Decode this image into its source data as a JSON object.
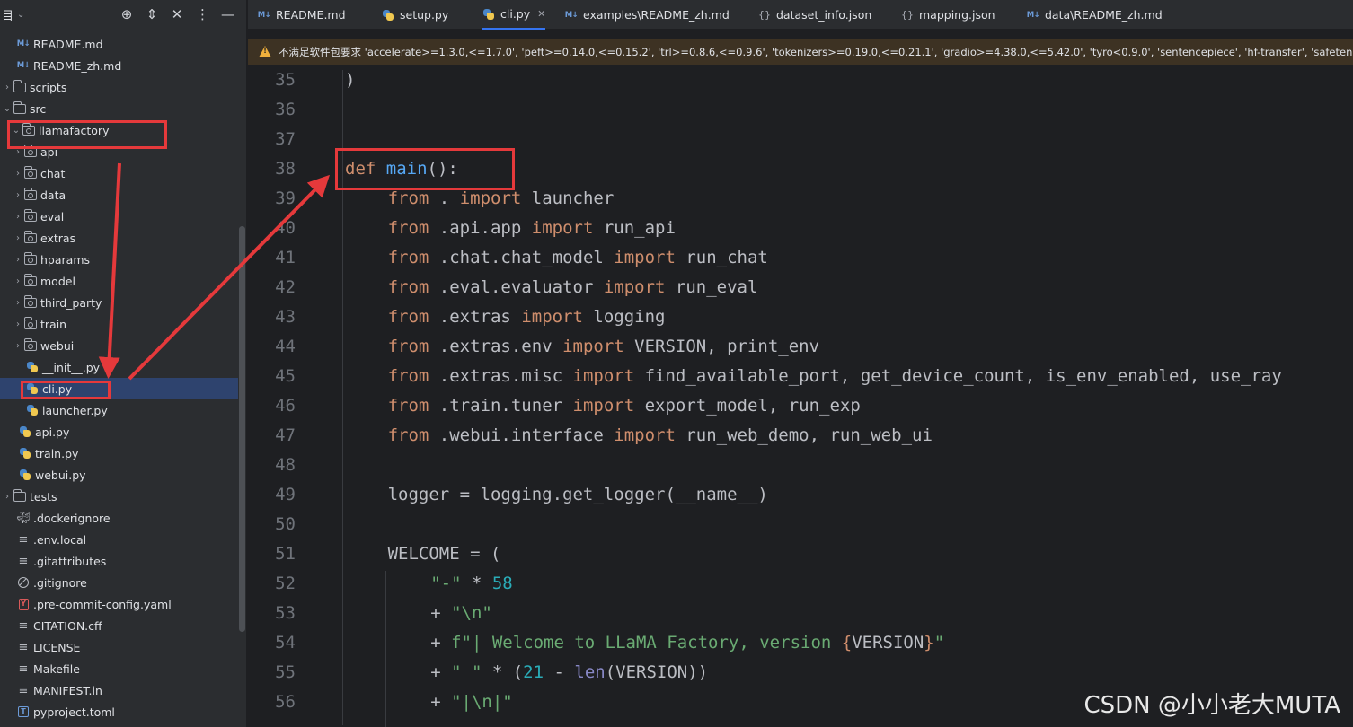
{
  "sidebar": {
    "title": "目",
    "tools": [
      "⊕",
      "⇕",
      "✕",
      "⋮",
      "—"
    ],
    "items": [
      {
        "label": "README.md",
        "icon": "markdown-icon",
        "indent": 2,
        "arrow": ""
      },
      {
        "label": "README_zh.md",
        "icon": "markdown-icon",
        "indent": 2,
        "arrow": ""
      },
      {
        "label": "scripts",
        "icon": "folder-icon",
        "indent": 1,
        "arrow": "›"
      },
      {
        "label": "src",
        "icon": "folder-icon",
        "indent": 1,
        "arrow": "⌄"
      },
      {
        "label": "llamafactory",
        "icon": "package-icon",
        "indent": 2,
        "arrow": "⌄"
      },
      {
        "label": "api",
        "icon": "package-icon",
        "indent": 3,
        "arrow": "›"
      },
      {
        "label": "chat",
        "icon": "package-icon",
        "indent": 3,
        "arrow": "›"
      },
      {
        "label": "data",
        "icon": "package-icon",
        "indent": 3,
        "arrow": "›"
      },
      {
        "label": "eval",
        "icon": "package-icon",
        "indent": 3,
        "arrow": "›"
      },
      {
        "label": "extras",
        "icon": "package-icon",
        "indent": 3,
        "arrow": "›"
      },
      {
        "label": "hparams",
        "icon": "package-icon",
        "indent": 3,
        "arrow": "›"
      },
      {
        "label": "model",
        "icon": "package-icon",
        "indent": 3,
        "arrow": "›"
      },
      {
        "label": "third_party",
        "icon": "package-icon",
        "indent": 3,
        "arrow": "›"
      },
      {
        "label": "train",
        "icon": "package-icon",
        "indent": 3,
        "arrow": "›"
      },
      {
        "label": "webui",
        "icon": "package-icon",
        "indent": 3,
        "arrow": "›"
      },
      {
        "label": "__init__.py",
        "icon": "python-icon",
        "indent": 4,
        "arrow": ""
      },
      {
        "label": "cli.py",
        "icon": "python-icon",
        "indent": 4,
        "arrow": "",
        "selected": true
      },
      {
        "label": "launcher.py",
        "icon": "python-icon",
        "indent": 4,
        "arrow": ""
      },
      {
        "label": "api.py",
        "icon": "python-icon",
        "indent": 3,
        "arrow": ""
      },
      {
        "label": "train.py",
        "icon": "python-icon",
        "indent": 3,
        "arrow": ""
      },
      {
        "label": "webui.py",
        "icon": "python-icon",
        "indent": 3,
        "arrow": ""
      },
      {
        "label": "tests",
        "icon": "folder-icon",
        "indent": 1,
        "arrow": "›"
      },
      {
        "label": ".dockerignore",
        "icon": "docker-icon",
        "indent": 2,
        "arrow": ""
      },
      {
        "label": ".env.local",
        "icon": "text-file-icon",
        "indent": 2,
        "arrow": ""
      },
      {
        "label": ".gitattributes",
        "icon": "text-file-icon",
        "indent": 2,
        "arrow": ""
      },
      {
        "label": ".gitignore",
        "icon": "ignore-file-icon",
        "indent": 2,
        "arrow": ""
      },
      {
        "label": ".pre-commit-config.yaml",
        "icon": "yaml-icon",
        "indent": 2,
        "arrow": ""
      },
      {
        "label": "CITATION.cff",
        "icon": "text-file-icon",
        "indent": 2,
        "arrow": ""
      },
      {
        "label": "LICENSE",
        "icon": "text-file-icon",
        "indent": 2,
        "arrow": ""
      },
      {
        "label": "Makefile",
        "icon": "text-file-icon",
        "indent": 2,
        "arrow": ""
      },
      {
        "label": "MANIFEST.in",
        "icon": "text-file-icon",
        "indent": 2,
        "arrow": ""
      },
      {
        "label": "pyproject.toml",
        "icon": "toml-icon",
        "indent": 2,
        "arrow": ""
      }
    ]
  },
  "tabs": [
    {
      "label": "README.md",
      "icon": "markdown-icon"
    },
    {
      "label": "setup.py",
      "icon": "python-icon"
    },
    {
      "label": "cli.py",
      "icon": "python-icon",
      "active": true,
      "close": "✕"
    },
    {
      "label": "examples\\README_zh.md",
      "icon": "markdown-icon"
    },
    {
      "label": "dataset_info.json",
      "icon": "json-icon"
    },
    {
      "label": "mapping.json",
      "icon": "json-icon"
    },
    {
      "label": "data\\README_zh.md",
      "icon": "markdown-icon"
    }
  ],
  "warning": "不满足软件包要求 'accelerate>=1.3.0,<=1.7.0', 'peft>=0.14.0,<=0.15.2', 'trl>=0.8.6,<=0.9.6', 'tokenizers>=0.19.0,<=0.21.1', 'gradio>=4.38.0,<=5.42.0', 'tyro<0.9.0', 'sentencepiece', 'hf-transfer', 'safetensors<=",
  "editor": {
    "lines": [
      {
        "n": "35",
        "indent": 0,
        "tokens": [
          [
            "",
            ")"
          ]
        ]
      },
      {
        "n": "36",
        "indent": 0,
        "tokens": []
      },
      {
        "n": "37",
        "indent": 0,
        "tokens": []
      },
      {
        "n": "38",
        "indent": 0,
        "tokens": [
          [
            "kw",
            "def "
          ],
          [
            "fn",
            "main"
          ],
          [
            "",
            "():"
          ]
        ]
      },
      {
        "n": "39",
        "indent": 1,
        "tokens": [
          [
            "kw",
            "from"
          ],
          [
            "",
            " . "
          ],
          [
            "kw",
            "import"
          ],
          [
            "",
            " launcher"
          ]
        ]
      },
      {
        "n": "40",
        "indent": 1,
        "tokens": [
          [
            "kw",
            "from"
          ],
          [
            "",
            " .api.app "
          ],
          [
            "kw",
            "import"
          ],
          [
            "",
            " run_api"
          ]
        ]
      },
      {
        "n": "41",
        "indent": 1,
        "tokens": [
          [
            "kw",
            "from"
          ],
          [
            "",
            " .chat.chat_model "
          ],
          [
            "kw",
            "import"
          ],
          [
            "",
            " run_chat"
          ]
        ]
      },
      {
        "n": "42",
        "indent": 1,
        "tokens": [
          [
            "kw",
            "from"
          ],
          [
            "",
            " .eval.evaluator "
          ],
          [
            "kw",
            "import"
          ],
          [
            "",
            " run_eval"
          ]
        ]
      },
      {
        "n": "43",
        "indent": 1,
        "tokens": [
          [
            "kw",
            "from"
          ],
          [
            "",
            " .extras "
          ],
          [
            "kw",
            "import"
          ],
          [
            "",
            " logging"
          ]
        ]
      },
      {
        "n": "44",
        "indent": 1,
        "tokens": [
          [
            "kw",
            "from"
          ],
          [
            "",
            " .extras.env "
          ],
          [
            "kw",
            "import"
          ],
          [
            "",
            " VERSION, print_env"
          ]
        ]
      },
      {
        "n": "45",
        "indent": 1,
        "tokens": [
          [
            "kw",
            "from"
          ],
          [
            "",
            " .extras.misc "
          ],
          [
            "kw",
            "import"
          ],
          [
            "",
            " find_available_port, get_device_count, is_env_enabled, use_ray"
          ]
        ]
      },
      {
        "n": "46",
        "indent": 1,
        "tokens": [
          [
            "kw",
            "from"
          ],
          [
            "",
            " .train.tuner "
          ],
          [
            "kw",
            "import"
          ],
          [
            "",
            " export_model, run_exp"
          ]
        ]
      },
      {
        "n": "47",
        "indent": 1,
        "tokens": [
          [
            "kw",
            "from"
          ],
          [
            "",
            " .webui.interface "
          ],
          [
            "kw",
            "import"
          ],
          [
            "",
            " run_web_demo, run_web_ui"
          ]
        ]
      },
      {
        "n": "48",
        "indent": 0,
        "tokens": []
      },
      {
        "n": "49",
        "indent": 1,
        "tokens": [
          [
            "",
            "logger = logging.get_logger(__name__)"
          ]
        ]
      },
      {
        "n": "50",
        "indent": 0,
        "tokens": []
      },
      {
        "n": "51",
        "indent": 1,
        "tokens": [
          [
            "",
            "WELCOME = ("
          ]
        ]
      },
      {
        "n": "52",
        "indent": 2,
        "tokens": [
          [
            "str",
            "\"-\""
          ],
          [
            "",
            " * "
          ],
          [
            "num",
            "58"
          ]
        ]
      },
      {
        "n": "53",
        "indent": 2,
        "tokens": [
          [
            "",
            "+ "
          ],
          [
            "str",
            "\"\\n\""
          ]
        ]
      },
      {
        "n": "54",
        "indent": 2,
        "tokens": [
          [
            "",
            "+ "
          ],
          [
            "str",
            "f\"| Welcome to LLaMA Factory, version "
          ],
          [
            "kw",
            "{"
          ],
          [
            "",
            "VERSION"
          ],
          [
            "kw",
            "}"
          ],
          [
            "str",
            "\""
          ]
        ]
      },
      {
        "n": "55",
        "indent": 2,
        "tokens": [
          [
            "",
            "+ "
          ],
          [
            "str",
            "\" \""
          ],
          [
            "",
            " * ("
          ],
          [
            "num",
            "21"
          ],
          [
            "",
            " - "
          ],
          [
            "bi",
            "len"
          ],
          [
            "",
            "(VERSION))"
          ]
        ]
      },
      {
        "n": "56",
        "indent": 2,
        "tokens": [
          [
            "",
            "+ "
          ],
          [
            "str",
            "\"|\\n|\""
          ]
        ]
      }
    ]
  },
  "watermark": "CSDN @小小老大MUTA",
  "colors": {
    "highlight": "#e5393b",
    "accent": "#3574f0"
  }
}
